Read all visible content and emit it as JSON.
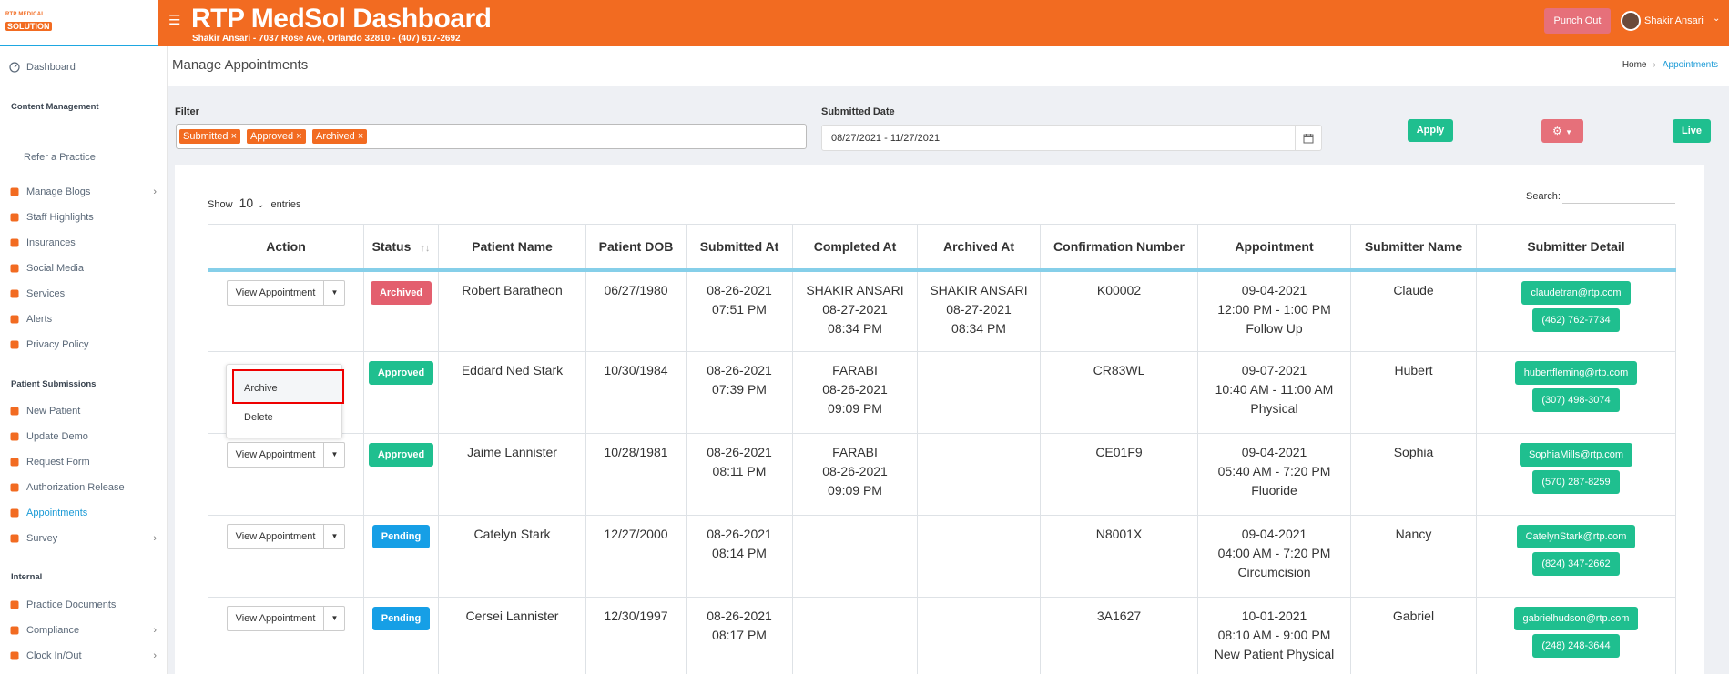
{
  "app": {
    "title": "RTP MedSol Dashboard",
    "subtitle": "Shakir Ansari - 7037 Rose Ave, Orlando 32810 - (407) 617-2692",
    "logo_top": "RTP MEDICAL",
    "logo_bottom": "SOLUTION",
    "punch_out": "Punch Out",
    "user_name": "Shakir Ansari"
  },
  "sidebar": {
    "dashboard": "Dashboard",
    "section_content": "Content Management",
    "refer": "Refer a Practice",
    "content_items": [
      {
        "label": "Manage Blogs",
        "chevron": true
      },
      {
        "label": "Staff Highlights"
      },
      {
        "label": "Insurances"
      },
      {
        "label": "Social Media"
      },
      {
        "label": "Services"
      },
      {
        "label": "Alerts"
      },
      {
        "label": "Privacy Policy"
      }
    ],
    "section_patient": "Patient Submissions",
    "patient_items": [
      {
        "label": "New Patient"
      },
      {
        "label": "Update Demo"
      },
      {
        "label": "Request Form"
      },
      {
        "label": "Authorization Release"
      },
      {
        "label": "Appointments",
        "active": true
      },
      {
        "label": "Survey",
        "chevron": true
      }
    ],
    "section_internal": "Internal",
    "internal_items": [
      {
        "label": "Practice Documents"
      },
      {
        "label": "Compliance",
        "chevron": true
      },
      {
        "label": "Clock In/Out",
        "chevron": true
      }
    ]
  },
  "page": {
    "title": "Manage Appointments",
    "breadcrumb_home": "Home",
    "breadcrumb_current": "Appointments"
  },
  "filters": {
    "filter_label": "Filter",
    "chips": [
      "Submitted ×",
      "Approved ×",
      "Archived ×"
    ],
    "date_label": "Submitted Date",
    "date_range": "08/27/2021 - 11/27/2021",
    "apply": "Apply",
    "live": "Live"
  },
  "table": {
    "show_label": "Show",
    "entries_value": "10",
    "entries_label": "entries",
    "search_label": "Search:",
    "columns": [
      "Action",
      "Status",
      "Patient Name",
      "Patient DOB",
      "Submitted At",
      "Completed At",
      "Archived At",
      "Confirmation Number",
      "Appointment",
      "Submitter Name",
      "Submitter Detail"
    ],
    "view_label": "View Appointment",
    "rows": [
      {
        "status": "Archived",
        "name": "Robert Baratheon",
        "dob": "06/27/1980",
        "sub1": "08-26-2021",
        "sub2": "07:51 PM",
        "comp1": "SHAKIR ANSARI",
        "comp2": "08-27-2021",
        "comp3": "08:34 PM",
        "arch1": "SHAKIR ANSARI",
        "arch2": "08-27-2021",
        "arch3": "08:34 PM",
        "conf": "K00002",
        "ap1": "09-04-2021",
        "ap2": "12:00 PM - 1:00 PM",
        "ap3": "Follow Up",
        "submitter": "Claude",
        "email": "claudetran@rtp.com",
        "phone": "(462) 762-7734"
      },
      {
        "status": "Approved",
        "name": "Eddard Ned Stark",
        "dob": "10/30/1984",
        "sub1": "08-26-2021",
        "sub2": "07:39 PM",
        "comp1": "FARABI",
        "comp2": "08-26-2021",
        "comp3": "09:09 PM",
        "arch1": "",
        "arch2": "",
        "arch3": "",
        "conf": "CR83WL",
        "ap1": "09-07-2021",
        "ap2": "10:40 AM - 11:00 AM",
        "ap3": "Physical",
        "submitter": "Hubert",
        "email": "hubertfleming@rtp.com",
        "phone": "(307) 498-3074"
      },
      {
        "status": "Approved",
        "name": "Jaime Lannister",
        "dob": "10/28/1981",
        "sub1": "08-26-2021",
        "sub2": "08:11 PM",
        "comp1": "FARABI",
        "comp2": "08-26-2021",
        "comp3": "09:09 PM",
        "arch1": "",
        "arch2": "",
        "arch3": "",
        "conf": "CE01F9",
        "ap1": "09-04-2021",
        "ap2": "05:40 AM - 7:20 PM",
        "ap3": "Fluoride",
        "submitter": "Sophia",
        "email": "SophiaMills@rtp.com",
        "phone": "(570) 287-8259"
      },
      {
        "status": "Pending",
        "name": "Catelyn Stark",
        "dob": "12/27/2000",
        "sub1": "08-26-2021",
        "sub2": "08:14 PM",
        "comp1": "",
        "comp2": "",
        "comp3": "",
        "arch1": "",
        "arch2": "",
        "arch3": "",
        "conf": "N8001X",
        "ap1": "09-04-2021",
        "ap2": "04:00 AM - 7:20 PM",
        "ap3": "Circumcision",
        "submitter": "Nancy",
        "email": "CatelynStark@rtp.com",
        "phone": "(824) 347-2662"
      },
      {
        "status": "Pending",
        "name": "Cersei Lannister",
        "dob": "12/30/1997",
        "sub1": "08-26-2021",
        "sub2": "08:17 PM",
        "comp1": "",
        "comp2": "",
        "comp3": "",
        "arch1": "",
        "arch2": "",
        "arch3": "",
        "conf": "3A1627",
        "ap1": "10-01-2021",
        "ap2": "08:10 AM - 9:00 PM",
        "ap3": "New Patient Physical",
        "submitter": "Gabriel",
        "email": "gabrielhudson@rtp.com",
        "phone": "(248) 248-3644"
      }
    ]
  },
  "dropdown_menu": {
    "archive": "Archive",
    "delete": "Delete"
  },
  "colors": {
    "brand_orange": "#f26b21",
    "accent_blue": "#1a9ad6",
    "green": "#1fbf8f",
    "red": "#e35f6e",
    "pending_blue": "#169fe6"
  }
}
